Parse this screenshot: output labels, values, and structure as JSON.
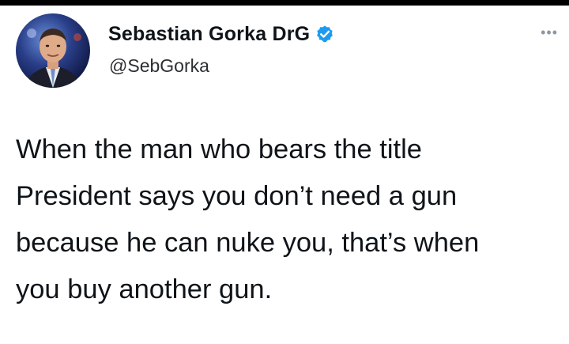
{
  "tweet": {
    "author": {
      "display_name": "Sebastian Gorka DrG",
      "handle": "@SebGorka",
      "verified": true,
      "avatar_icon": "profile-photo"
    },
    "more_icon": "more-horizontal-icon",
    "text_lines": [
      "When the man who bears the title",
      "President says you don’t need a gun",
      "because he can nuke you, that’s when",
      "you buy another gun."
    ]
  },
  "colors": {
    "verified_badge": "#1d9bf0",
    "text": "#0f1419",
    "muted": "#8b98a5"
  }
}
